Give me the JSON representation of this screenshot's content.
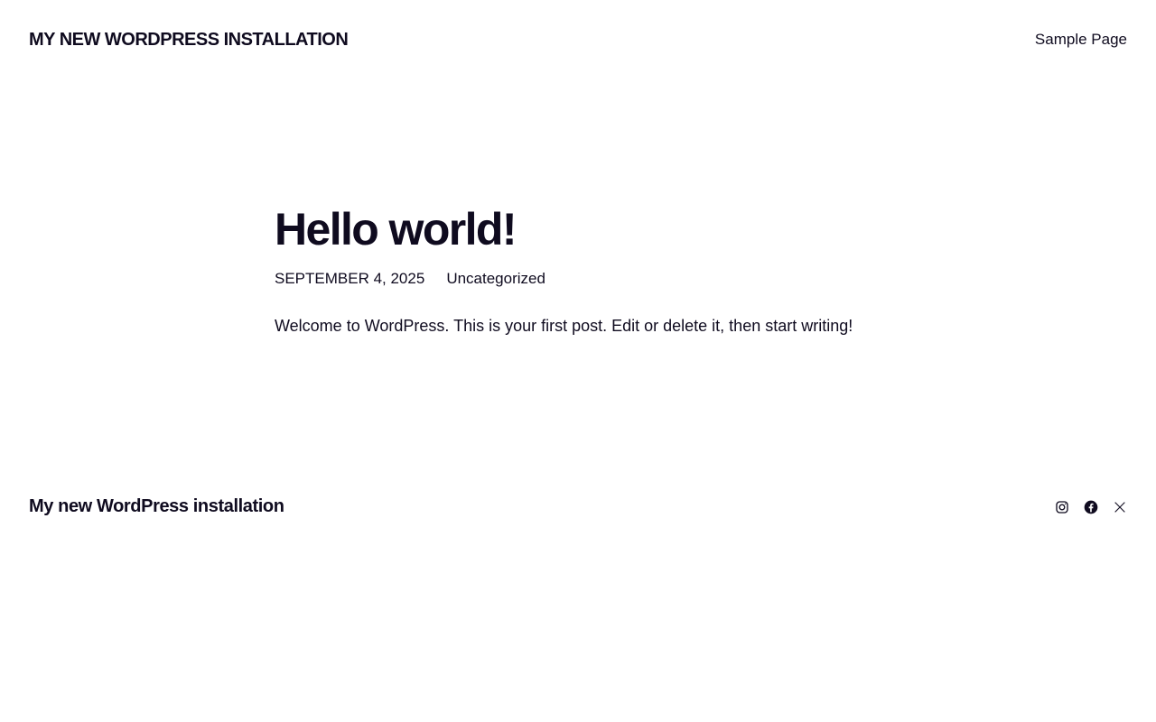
{
  "header": {
    "site_title": "MY NEW WORDPRESS INSTALLATION",
    "nav": [
      {
        "label": "Sample Page"
      }
    ]
  },
  "post": {
    "title": "Hello world!",
    "date": "SEPTEMBER 4, 2025",
    "category": "Uncategorized",
    "content": "Welcome to WordPress. This is your first post. Edit or delete it, then start writing!"
  },
  "footer": {
    "site_title": "My new WordPress installation",
    "social": [
      {
        "icon": "instagram-icon"
      },
      {
        "icon": "facebook-icon"
      },
      {
        "icon": "x-icon"
      }
    ]
  },
  "colors": {
    "text": "#0f0b1f",
    "background": "#ffffff"
  }
}
